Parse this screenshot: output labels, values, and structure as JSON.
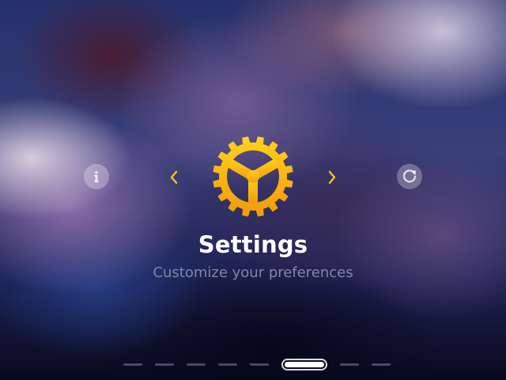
{
  "screen": {
    "title": "Settings",
    "subtitle": "Customize your preferences"
  },
  "icons": {
    "info": "info-icon",
    "refresh": "refresh-icon",
    "prev": "chevron-left-icon",
    "next": "chevron-right-icon",
    "main": "gear-icon"
  },
  "colors": {
    "accent": "#f5c518",
    "accent_dark": "#f09b0a",
    "title": "#ffffff",
    "subtitle": "#7f86a8"
  },
  "pager": {
    "total": 8,
    "active_index": 5
  }
}
